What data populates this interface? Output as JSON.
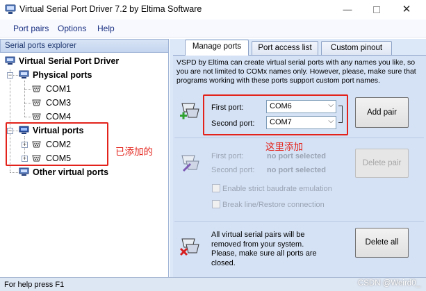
{
  "window": {
    "title": "Virtual Serial Port Driver 7.2 by Eltima Software",
    "minimize_glyph": "—",
    "close_glyph": "✕"
  },
  "menu": [
    "Port pairs",
    "Options",
    "Help"
  ],
  "left_panel": {
    "header": "Serial ports explorer",
    "root": "Virtual Serial Port Driver",
    "physical_ports": {
      "label": "Physical ports",
      "items": [
        "COM1",
        "COM3",
        "COM4"
      ]
    },
    "virtual_ports": {
      "label": "Virtual ports",
      "items": [
        "COM2",
        "COM5"
      ]
    },
    "other_virtual_ports": "Other virtual ports",
    "annotation": "已添加的"
  },
  "tabs": [
    {
      "label": "Manage ports",
      "active": true
    },
    {
      "label": "Port access list",
      "active": false
    },
    {
      "label": "Custom pinout",
      "active": false
    }
  ],
  "manage": {
    "description": "VSPD by Eltima can create virtual serial ports with any names you like, so you are not limited to COMx names only. However, please, make sure that programs working with these ports support custom port names.",
    "add": {
      "first_port_label": "First port:",
      "first_port_value": "COM6",
      "second_port_label": "Second port:",
      "second_port_value": "COM7",
      "button": "Add pair",
      "annotation": "这里添加",
      "dropdown_glyph": "⌵"
    },
    "delete": {
      "first_port_label": "First port:",
      "first_port_value": "no port selected",
      "second_port_label": "Second port:",
      "second_port_value": "no port selected",
      "button": "Delete pair",
      "checkbox1": "Enable strict baudrate emulation",
      "checkbox2": "Break line/Restore connection"
    },
    "delete_all": {
      "text": "All virtual serial pairs will be removed from your system. Please, make sure all ports are closed.",
      "button": "Delete all"
    }
  },
  "status": {
    "text": "For help press F1",
    "watermark": "CSDN @Weird0_"
  },
  "colors": {
    "accent_red": "#e3231b",
    "menu_text": "#1a2f80",
    "panel_bg": "#d5e2f5"
  }
}
